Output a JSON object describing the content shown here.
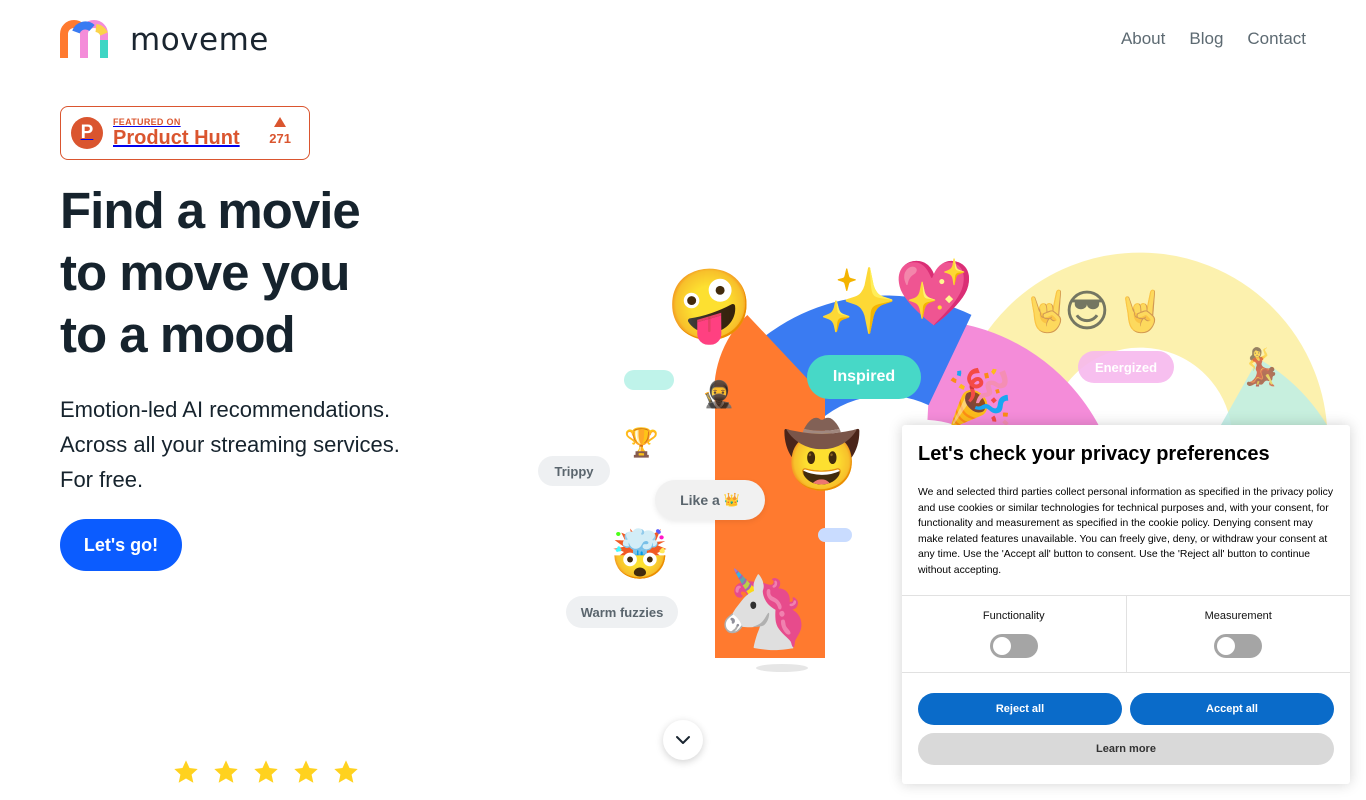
{
  "header": {
    "logo_text": "moveme",
    "nav": [
      {
        "label": "About"
      },
      {
        "label": "Blog"
      },
      {
        "label": "Contact"
      }
    ]
  },
  "product_hunt": {
    "featured_label": "FEATURED ON",
    "name": "Product Hunt",
    "letter": "P",
    "votes": "271"
  },
  "hero": {
    "title_lines": [
      "Find a movie",
      "to move you",
      "to a mood"
    ],
    "sub_lines": [
      "Emotion-led AI recommendations.",
      "Across all your streaming services.",
      "For free."
    ],
    "cta_label": "Let's go!"
  },
  "illustration": {
    "chips": {
      "inspired": "Inspired",
      "energized": "Energized",
      "trippy": "Trippy",
      "like_a": "Like a",
      "warm_fuzzies": "Warm fuzzies"
    },
    "emojis": {
      "zany": "🤪",
      "heart": "💖",
      "sparkles": "✨",
      "cowboy": "🤠",
      "unicorn": "🦄",
      "exploding": "🤯",
      "trophy": "🏆",
      "crown": "👑",
      "ninja": "🥷",
      "party": "🎉",
      "rock": "🤘",
      "cool": "😎",
      "dancer": "💃"
    }
  },
  "rating": {
    "stars": 5
  },
  "cookie": {
    "title": "Let's check your privacy preferences",
    "body": "We and selected third parties collect personal information as specified in the privacy policy and use cookies or similar technologies for technical purposes and, with your consent, for functionality and measurement as specified in the cookie policy. Denying consent may make related features unavailable. You can freely give, deny, or withdraw your consent at any time. Use the 'Accept all' button to consent. Use the 'Reject all' button to continue without accepting.",
    "options": [
      {
        "label": "Functionality",
        "enabled": false
      },
      {
        "label": "Measurement",
        "enabled": false
      }
    ],
    "reject_label": "Reject all",
    "accept_label": "Accept all",
    "learn_label": "Learn more"
  },
  "colors": {
    "primary": "#0b5cff",
    "product_hunt": "#da552f",
    "cookie_button": "#0a6bc9",
    "arc_orange": "#ff7a2f",
    "arc_blue": "#3a7bf2",
    "arc_pink": "#f48cd9",
    "arc_yellow": "#fbe98a",
    "arc_teal": "#7de0d2"
  }
}
